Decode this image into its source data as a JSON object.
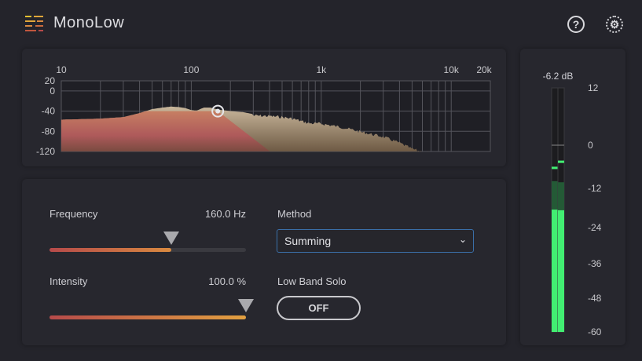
{
  "header": {
    "title": "MonoLow",
    "help_icon": "question-circle-icon",
    "settings_icon": "gear-icon"
  },
  "colors": {
    "accent_red": "#b64a4a",
    "accent_orange": "#e2a040",
    "meter_green": "#3ff06e",
    "select_border": "#3a6fa8"
  },
  "chart_data": {
    "type": "area",
    "x_scale": "log",
    "xlim": [
      10,
      20000
    ],
    "ylim": [
      -120,
      20
    ],
    "x_ticks": [
      "10",
      "100",
      "1k",
      "10k",
      "20k"
    ],
    "y_ticks": [
      "20",
      "0",
      "-40",
      "-80",
      "-120"
    ],
    "grid": true,
    "crossover_hz": 160,
    "spectrum": [
      [
        10,
        -57
      ],
      [
        20,
        -55
      ],
      [
        30,
        -52
      ],
      [
        40,
        -44
      ],
      [
        50,
        -36
      ],
      [
        60,
        -33
      ],
      [
        70,
        -31
      ],
      [
        80,
        -32
      ],
      [
        90,
        -34
      ],
      [
        100,
        -38
      ],
      [
        110,
        -39
      ],
      [
        125,
        -33
      ],
      [
        140,
        -33
      ],
      [
        160,
        -37
      ],
      [
        200,
        -40
      ],
      [
        250,
        -42
      ],
      [
        300,
        -46
      ],
      [
        400,
        -47
      ],
      [
        500,
        -49
      ],
      [
        600,
        -52
      ],
      [
        800,
        -61
      ],
      [
        1000,
        -62
      ],
      [
        1500,
        -70
      ],
      [
        2000,
        -78
      ],
      [
        3000,
        -88
      ],
      [
        4000,
        -100
      ],
      [
        5000,
        -112
      ],
      [
        6000,
        -118
      ],
      [
        7000,
        -120
      ]
    ]
  },
  "controls": {
    "frequency": {
      "label": "Frequency",
      "value": "160.0 Hz",
      "fraction": 0.62
    },
    "intensity": {
      "label": "Intensity",
      "value": "100.0 %",
      "fraction": 1.0
    },
    "method": {
      "label": "Method",
      "selected": "Summing"
    },
    "low_band_solo": {
      "label": "Low Band Solo",
      "state": "OFF"
    }
  },
  "meter": {
    "readout": "-6.2 dB",
    "scale": [
      "12",
      "0",
      "-12",
      "-24",
      "-36",
      "-48",
      "-60"
    ],
    "left": {
      "rms_db": -18.5,
      "peak_db": -10,
      "hold_db": -6.2
    },
    "right": {
      "rms_db": -18.7,
      "peak_db": -10.3,
      "hold_db": -4.5
    }
  }
}
